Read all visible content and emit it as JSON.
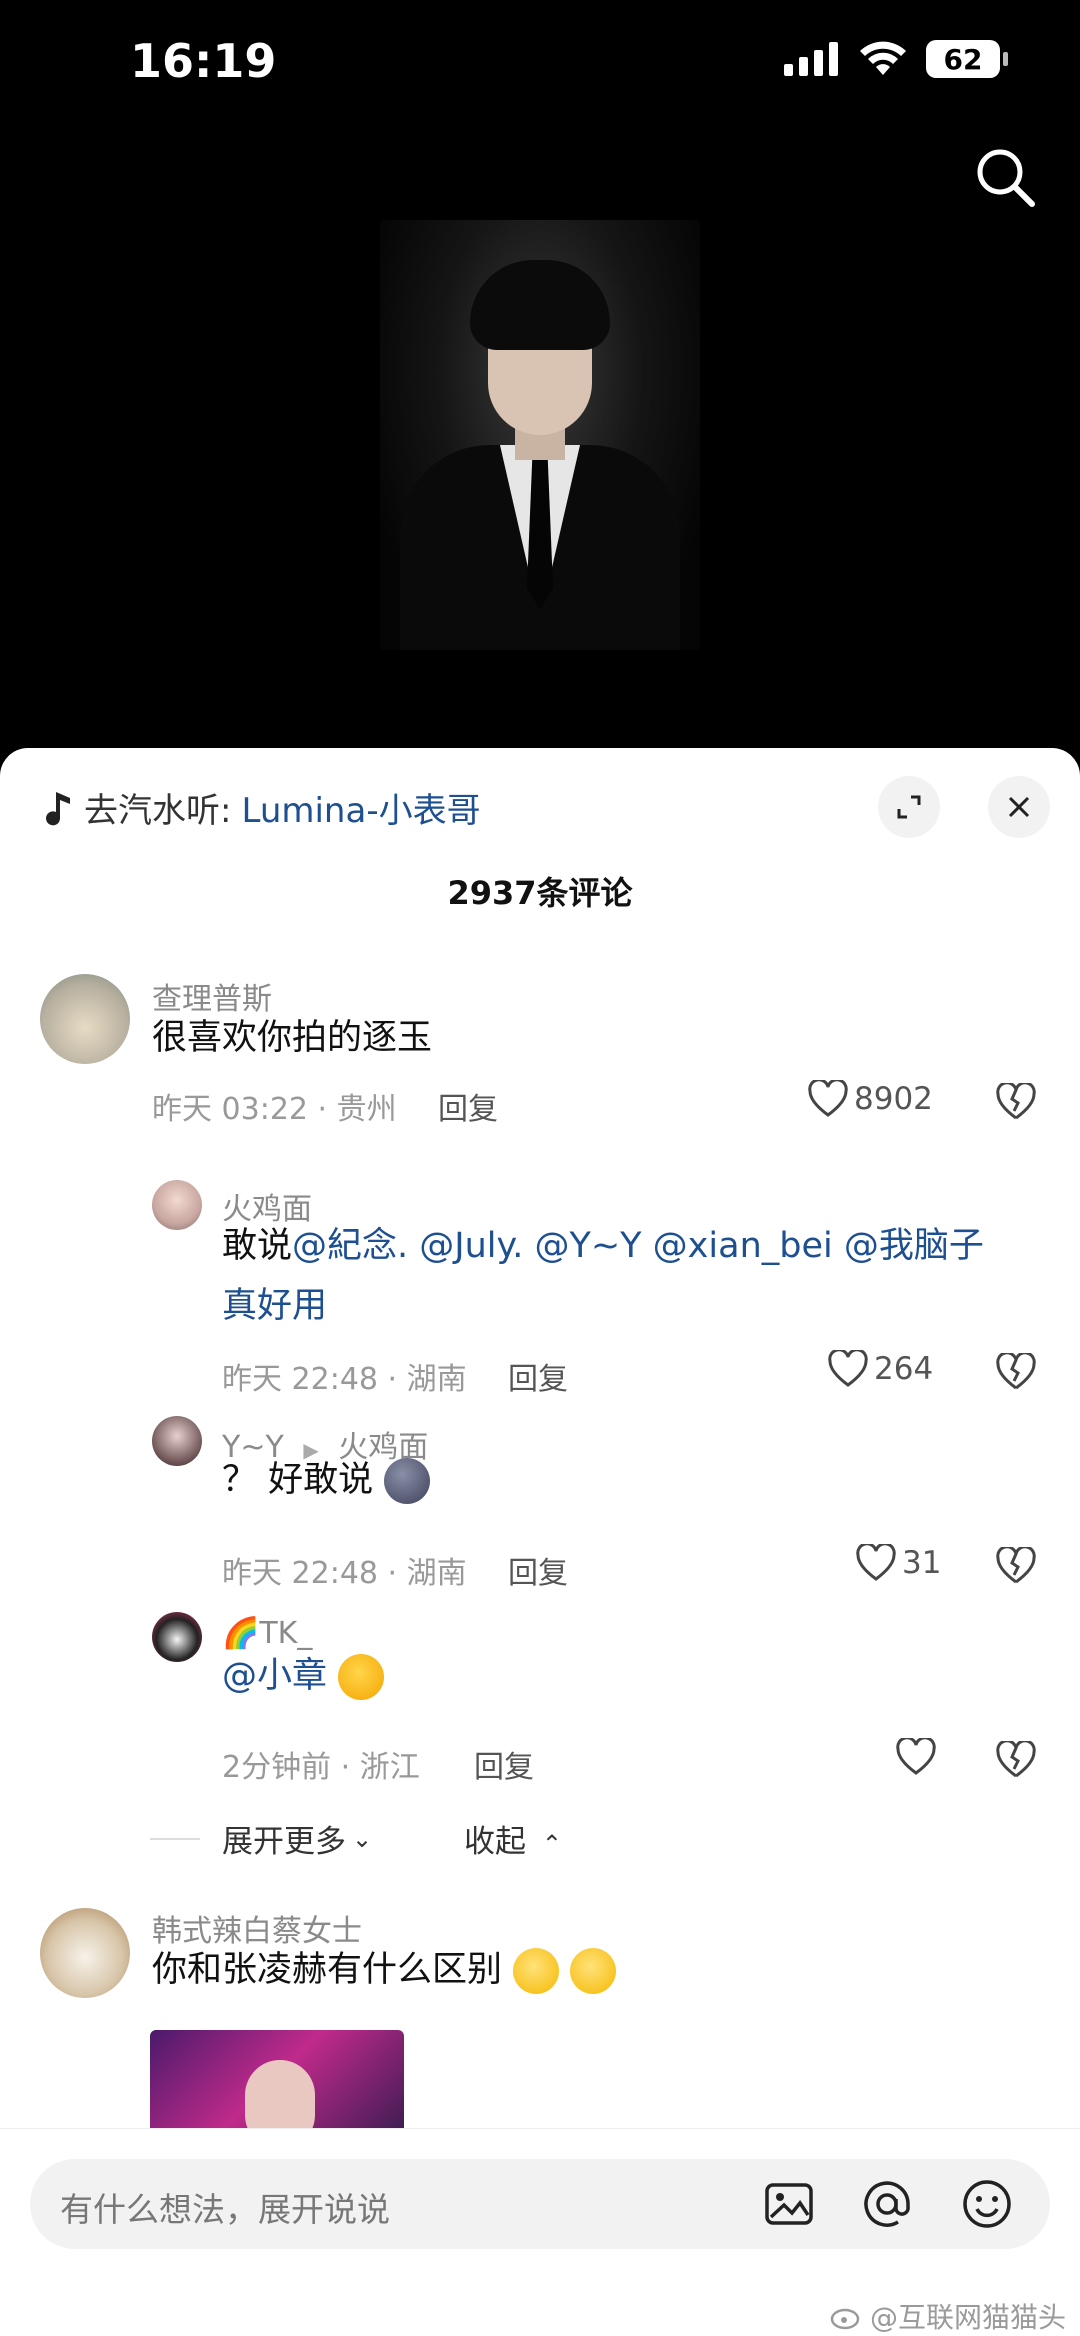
{
  "status_bar": {
    "time": "16:19",
    "battery": "62"
  },
  "sheet": {
    "music_prefix": "去汽水听:",
    "music_link": "Lumina-小表哥",
    "comment_count": "2937条评论"
  },
  "comments": [
    {
      "user": "查理普斯",
      "text": "很喜欢你拍的逐玉",
      "meta": "昨天 03:22 · 贵州",
      "reply": "回复",
      "likes": "8902"
    },
    {
      "user": "韩式辣白蔡女士",
      "text": "你和张凌赫有什么区别"
    }
  ],
  "replies": [
    {
      "user": "火鸡面",
      "text_prefix": "敢说",
      "mentions_line1": "@紀念. @July. @Y~Y @xian_bei @我脑子",
      "mentions_line2": "真好用",
      "meta": "昨天 22:48 · 湖南",
      "reply": "回复",
      "likes": "264"
    },
    {
      "user": "Y~Y",
      "reply_to": "火鸡面",
      "text": "？ 好敢说",
      "meta": "昨天 22:48 · 湖南",
      "reply": "回复",
      "likes": "31"
    },
    {
      "user": "🌈TK_",
      "mention": "@小章",
      "meta": "2分钟前 · 浙江",
      "reply": "回复",
      "likes": ""
    }
  ],
  "expand_more": "展开更多",
  "collapse": "收起",
  "input": {
    "placeholder": "有什么想法，展开说说"
  },
  "watermark": "@互联网猫猫头",
  "icons": {
    "search": "search-icon",
    "music": "music-note-icon",
    "expand": "expand-icon",
    "close": "close-icon",
    "heart": "heart-icon",
    "broken_heart": "broken-heart-icon",
    "image": "image-icon",
    "at": "at-icon",
    "emoji": "emoji-icon"
  }
}
